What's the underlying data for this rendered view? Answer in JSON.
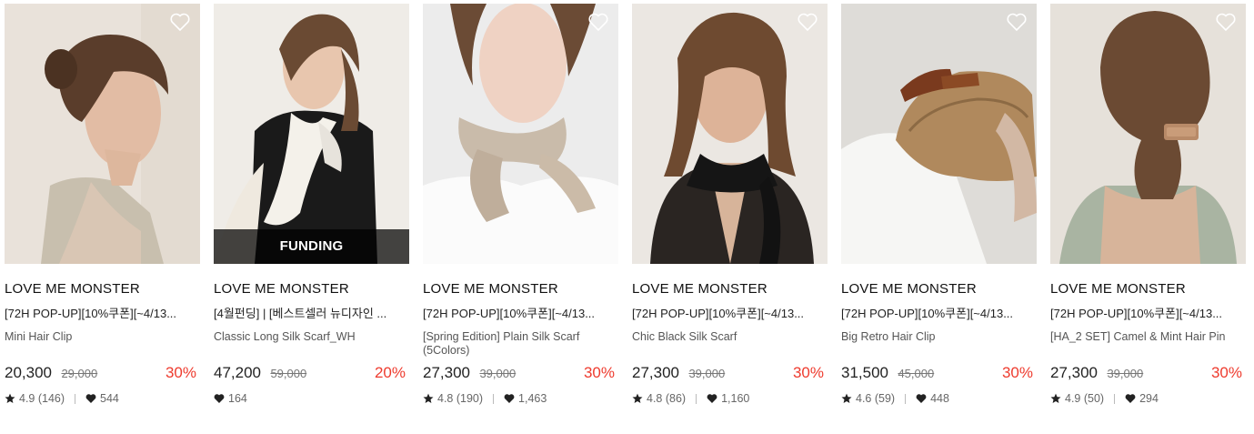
{
  "products": [
    {
      "brand": "LOVE ME MONSTER",
      "title": "[72H POP-UP][10%쿠폰][~4/13...",
      "subtitle": "Mini Hair Clip",
      "price": "20,300",
      "original_price": "29,000",
      "discount": "30%",
      "rating": "4.9 (146)",
      "likes": "544",
      "badge": ""
    },
    {
      "brand": "LOVE ME MONSTER",
      "title": "[4월펀딩] | [베스트셀러 뉴디자인 ...",
      "subtitle": "Classic Long Silk Scarf_WH",
      "price": "47,200",
      "original_price": "59,000",
      "discount": "20%",
      "rating": "",
      "likes": "164",
      "badge": "FUNDING"
    },
    {
      "brand": "LOVE ME MONSTER",
      "title": "[72H POP-UP][10%쿠폰][~4/13...",
      "subtitle": "[Spring Edition] Plain Silk Scarf (5Colors)",
      "price": "27,300",
      "original_price": "39,000",
      "discount": "30%",
      "rating": "4.8 (190)",
      "likes": "1,463",
      "badge": ""
    },
    {
      "brand": "LOVE ME MONSTER",
      "title": "[72H POP-UP][10%쿠폰][~4/13...",
      "subtitle": "Chic Black Silk Scarf",
      "price": "27,300",
      "original_price": "39,000",
      "discount": "30%",
      "rating": "4.8 (86)",
      "likes": "1,160",
      "badge": ""
    },
    {
      "brand": "LOVE ME MONSTER",
      "title": "[72H POP-UP][10%쿠폰][~4/13...",
      "subtitle": "Big Retro Hair Clip",
      "price": "31,500",
      "original_price": "45,000",
      "discount": "30%",
      "rating": "4.6 (59)",
      "likes": "448",
      "badge": ""
    },
    {
      "brand": "LOVE ME MONSTER",
      "title": "[72H POP-UP][10%쿠폰][~4/13...",
      "subtitle": "[HA_2 SET] Camel & Mint Hair Pin",
      "price": "27,300",
      "original_price": "39,000",
      "discount": "30%",
      "rating": "4.9 (50)",
      "likes": "294",
      "badge": ""
    }
  ],
  "icons": {
    "wishlist": "heart-outline-icon",
    "rating": "star-icon",
    "likes": "heart-filled-icon"
  },
  "colors": {
    "discount": "#ee3b2e",
    "funding_overlay": "#000000"
  }
}
